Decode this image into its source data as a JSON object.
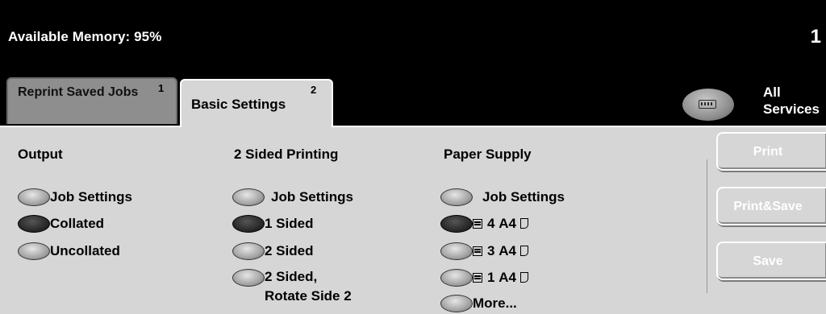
{
  "status": {
    "memory_label": "Available Memory: 95%",
    "counter": "1"
  },
  "tabs": [
    {
      "label": "Reprint Saved Jobs",
      "number": "1",
      "selected": false
    },
    {
      "label": "Basic Settings",
      "number": "2",
      "selected": true
    }
  ],
  "services": {
    "label_line1": "All",
    "label_line2": "Services",
    "icon": "keypad-icon"
  },
  "output": {
    "heading": "Output",
    "options": [
      {
        "label": "Job Settings",
        "selected": false
      },
      {
        "label": "Collated",
        "selected": true
      },
      {
        "label": "Uncollated",
        "selected": false
      }
    ]
  },
  "two_sided": {
    "heading": "2 Sided Printing",
    "options": [
      {
        "label": "Job Settings",
        "selected": false
      },
      {
        "label": "1 Sided",
        "selected": true
      },
      {
        "label": "2 Sided",
        "selected": false
      },
      {
        "label": "2 Sided,",
        "label_line2": "Rotate Side 2",
        "selected": false
      }
    ]
  },
  "paper_supply": {
    "heading": "Paper Supply",
    "options": [
      {
        "label": "Job Settings",
        "selected": false
      },
      {
        "tray": "4",
        "size": "A4",
        "selected": true
      },
      {
        "tray": "3",
        "size": "A4",
        "selected": false
      },
      {
        "tray": "1",
        "size": "A4",
        "selected": false
      },
      {
        "label": "More...",
        "selected": false
      }
    ]
  },
  "actions": {
    "print": "Print",
    "print_save": "Print&Save",
    "save": "Save"
  },
  "colors": {
    "panel": "#d6d6d6",
    "background": "#000000",
    "inactive_tab": "#8e8e8e"
  }
}
